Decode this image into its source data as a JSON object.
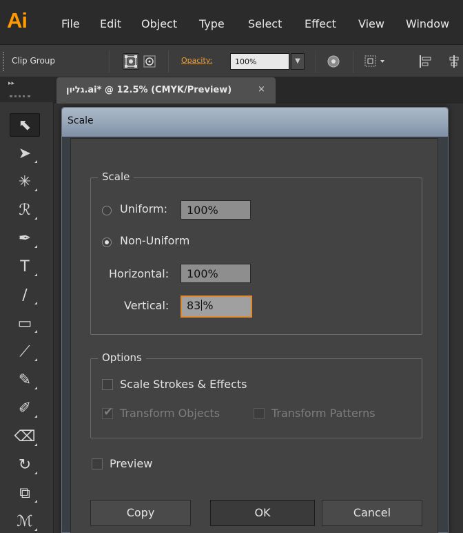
{
  "app": {
    "logo": "Ai"
  },
  "menu": {
    "items": [
      "File",
      "Edit",
      "Object",
      "Type",
      "Select",
      "Effect",
      "View",
      "Window"
    ]
  },
  "control_bar": {
    "selection_label": "Clip Group",
    "opacity_label": "Opacity:",
    "opacity_value": "100%"
  },
  "tabs": [
    {
      "label": "גליון.ai* @ 12.5% (CMYK/Preview)",
      "close": "×"
    }
  ],
  "tools": [
    {
      "name": "selection-tool-icon",
      "glyph": "⬉",
      "active": true
    },
    {
      "name": "direct-selection-tool-icon",
      "glyph": "➤",
      "active": false
    },
    {
      "name": "magic-wand-tool-icon",
      "glyph": "✳",
      "active": false
    },
    {
      "name": "lasso-tool-icon",
      "glyph": "ℛ",
      "active": false
    },
    {
      "name": "pen-tool-icon",
      "glyph": "✒",
      "active": false
    },
    {
      "name": "type-tool-icon",
      "glyph": "T",
      "active": false
    },
    {
      "name": "line-tool-icon",
      "glyph": "∕",
      "active": false
    },
    {
      "name": "rectangle-tool-icon",
      "glyph": "▭",
      "active": false
    },
    {
      "name": "paintbrush-tool-icon",
      "glyph": "⟋",
      "active": false
    },
    {
      "name": "pencil-tool-icon",
      "glyph": "✎",
      "active": false
    },
    {
      "name": "blob-brush-tool-icon",
      "glyph": "✐",
      "active": false
    },
    {
      "name": "eraser-tool-icon",
      "glyph": "⌫",
      "active": false
    },
    {
      "name": "rotate-tool-icon",
      "glyph": "↻",
      "active": false
    },
    {
      "name": "scale-tool-icon",
      "glyph": "⧉",
      "active": false
    },
    {
      "name": "width-tool-icon",
      "glyph": "ℳ",
      "active": false
    }
  ],
  "dialog": {
    "title": "Scale",
    "scale_group": {
      "legend": "Scale",
      "uniform_label": "Uniform:",
      "uniform_value": "100%",
      "uniform_checked": false,
      "non_uniform_label": "Non-Uniform",
      "non_uniform_checked": true,
      "horizontal_label": "Horizontal:",
      "horizontal_value": "100%",
      "vertical_label": "Vertical:",
      "vertical_value_before_caret": "83",
      "vertical_value_after_caret": "%"
    },
    "options_group": {
      "legend": "Options",
      "scale_strokes_label": "Scale Strokes & Effects",
      "scale_strokes_checked": false,
      "transform_objects_label": "Transform Objects",
      "transform_objects_checked": true,
      "transform_objects_disabled": true,
      "transform_patterns_label": "Transform Patterns",
      "transform_patterns_checked": false,
      "transform_patterns_disabled": true
    },
    "preview_label": "Preview",
    "preview_checked": false,
    "buttons": {
      "copy": "Copy",
      "ok": "OK",
      "cancel": "Cancel"
    }
  },
  "colors": {
    "logo": "#ff9a00",
    "focus_ring": "#e08a2c",
    "opacity_link": "#f0a030"
  }
}
